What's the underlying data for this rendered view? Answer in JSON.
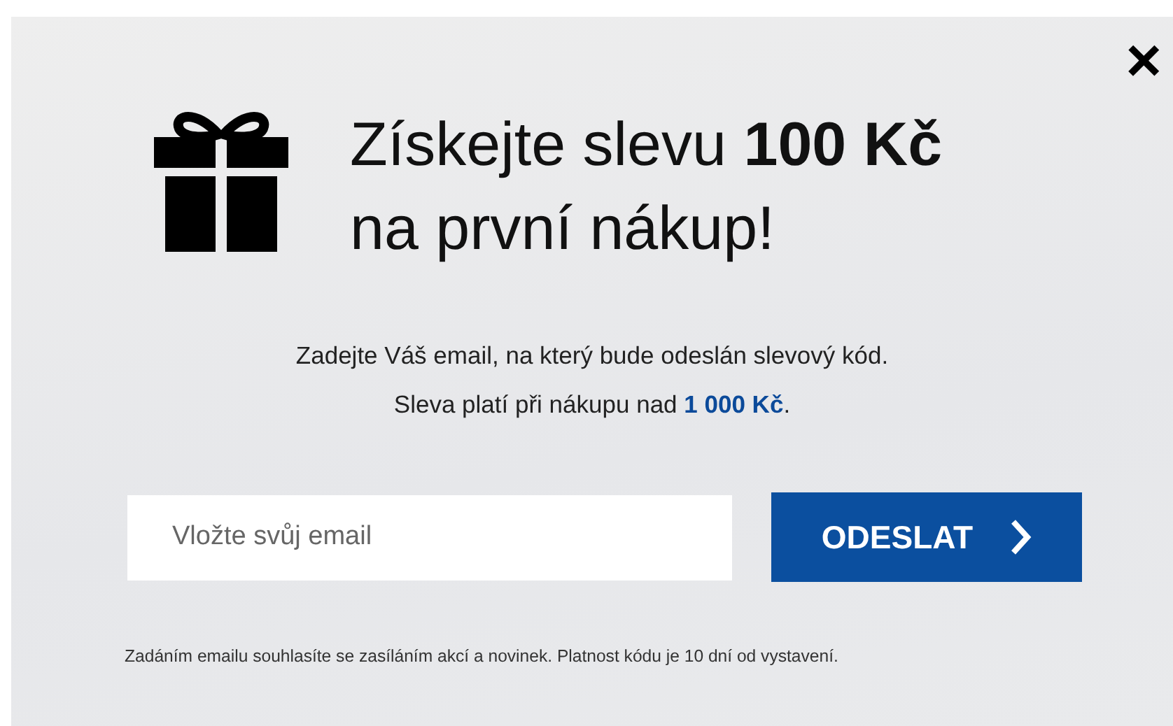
{
  "close": "×",
  "heading_lines": [
    "Získejte slevu **100 Kč**",
    "na první nákup!"
  ],
  "info_lines": [
    "Zadejte Váš email, na který bude odeslán slevový kód.",
    "Sleva platí při nákupu nad **1 000 Kč**."
  ],
  "email_field": {
    "placeholder": "Vložte svůj email"
  },
  "submit_button": {
    "label": "ODESLAT"
  },
  "footer_note": "Zadáním emailu souhlasíte se zasíláním akcí a novinek. Platnost kódu je 10 dní od vystavení."
}
